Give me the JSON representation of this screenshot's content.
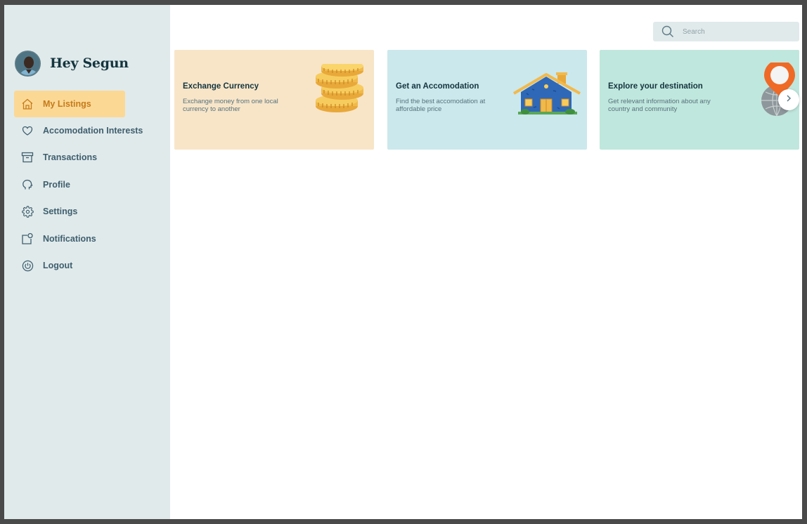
{
  "user": {
    "greeting": "Hey Segun"
  },
  "sidebar": {
    "items": [
      {
        "label": "My Listings",
        "icon": "home-icon",
        "active": true
      },
      {
        "label": "Accomodation Interests",
        "icon": "heart-icon",
        "active": false
      },
      {
        "label": "Transactions",
        "icon": "archive-box-icon",
        "active": false
      },
      {
        "label": "Profile",
        "icon": "profile-head-icon",
        "active": false
      },
      {
        "label": "Settings",
        "icon": "gear-icon",
        "active": false
      },
      {
        "label": "Notifications",
        "icon": "notification-icon",
        "active": false
      },
      {
        "label": "Logout",
        "icon": "power-icon",
        "active": false
      }
    ]
  },
  "search": {
    "placeholder": "Search"
  },
  "cards": [
    {
      "title": "Exchange Currency",
      "description": "Exchange money from one local currency to another",
      "icon": "coins-icon",
      "background": "#f8e5c8"
    },
    {
      "title": "Get an Accomodation",
      "description": "Find the best accomodation at affordable price",
      "icon": "house-icon",
      "background": "#cbe8ec"
    },
    {
      "title": "Explore your destination",
      "description": "Get relevant information about any country and community",
      "icon": "globe-pin-icon",
      "background": "#c0e7dd"
    }
  ],
  "colors": {
    "sidebar_bg": "#e1eaeb",
    "active_item_bg": "#fcd895",
    "active_item_text": "#c57b1a",
    "nav_text": "#3e5f6e",
    "heading": "#14353f"
  }
}
